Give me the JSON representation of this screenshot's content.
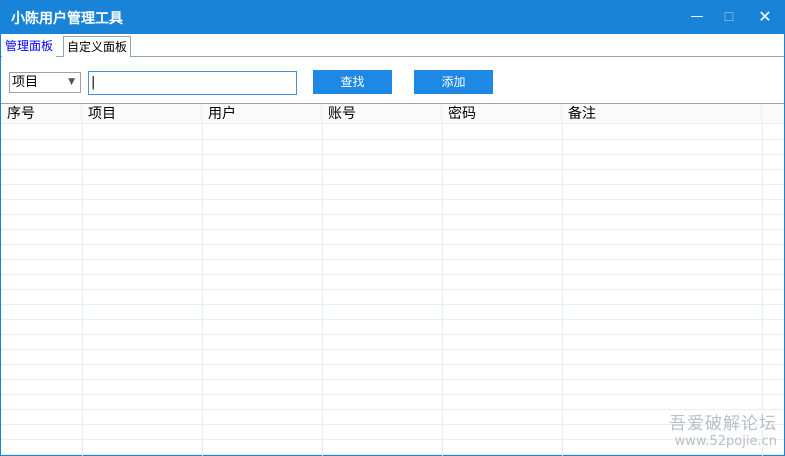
{
  "window": {
    "title": "小陈用户管理工具",
    "minimize": "—",
    "maximize": "☐",
    "close": "✕"
  },
  "tabs": [
    {
      "label": "管理面板",
      "active": true
    },
    {
      "label": "自定义面板",
      "active": false
    }
  ],
  "toolbar": {
    "select_value": "项目",
    "search_value": "|",
    "find_label": "查找",
    "add_label": "添加"
  },
  "table": {
    "columns": [
      "序号",
      "项目",
      "用户",
      "账号",
      "密码",
      "备注"
    ],
    "rows": []
  },
  "watermark": {
    "line1": "吾爱破解论坛",
    "line2": "www.52pojie.cn"
  }
}
